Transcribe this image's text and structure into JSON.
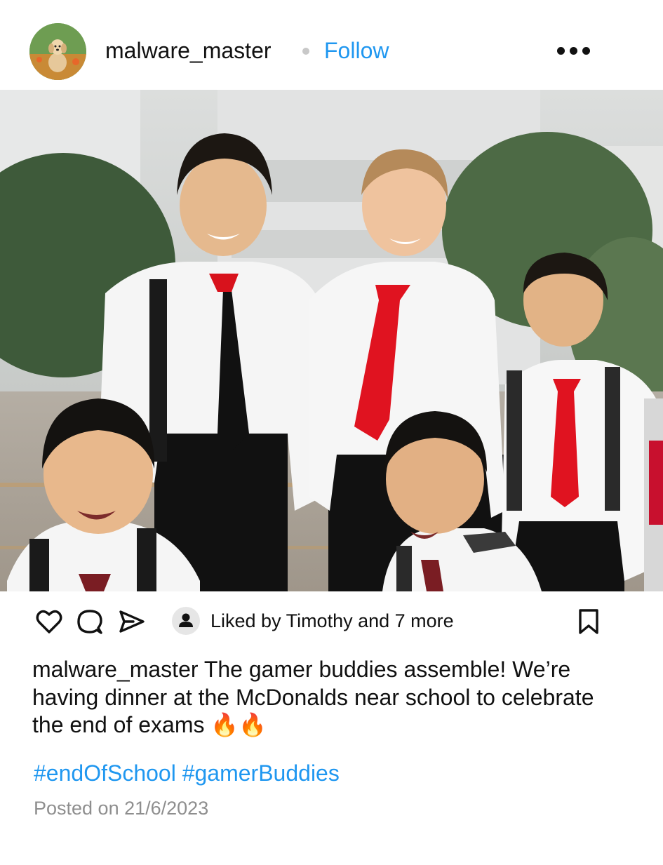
{
  "post": {
    "username": "malware_master",
    "follow_label": "Follow",
    "liked_by": "Liked by Timothy and 7 more",
    "caption_username": "malware_master",
    "caption_text": "The gamer buddies assemble! We’re having dinner at the McDonalds near school to celebrate the end of exams 🔥🔥",
    "hashtags": [
      "#endOfSchool",
      "#gamerBuddies"
    ],
    "posted_on": "Posted on 21/6/2023"
  },
  "icons": {
    "more": "more-options-icon",
    "like": "heart-icon",
    "comment": "comment-icon",
    "share": "share-icon",
    "liked_avatar": "user-icon",
    "save": "bookmark-icon"
  },
  "colors": {
    "accent": "#1f97f0",
    "muted": "#8e8e8e",
    "text": "#111111"
  }
}
